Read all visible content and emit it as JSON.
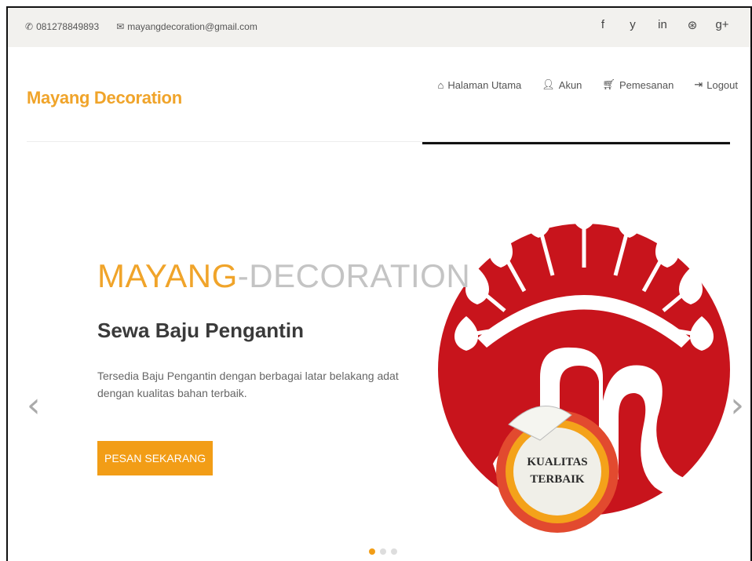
{
  "topbar": {
    "phone": "081278849893",
    "email": "mayangdecoration@gmail.com",
    "social": [
      "f",
      "y",
      "in",
      "⊛",
      "g+"
    ]
  },
  "header": {
    "brand": "Mayang Decoration",
    "nav": [
      {
        "icon": "home-icon",
        "label": "Halaman Utama"
      },
      {
        "icon": "user-icon",
        "label": "Akun"
      },
      {
        "icon": "cart-icon",
        "label": "Pemesanan"
      },
      {
        "icon": "logout-icon",
        "label": "Logout"
      }
    ]
  },
  "slide": {
    "headline_accent": "MAYANG",
    "headline_rest": "-DECORATION",
    "subhead": "Sewa Baju Pengantin",
    "description": "Tersedia Baju Pengantin dengan berbagai latar belakang adat dengan kualitas bahan terbaik.",
    "cta": "PESAN SEKARANG",
    "badge_line1": "KUALITAS",
    "badge_line2": "TERBAIK",
    "prev": "‹",
    "next": "›",
    "active_dot": 0,
    "dot_count": 3
  },
  "colors": {
    "accent": "#f0a42a",
    "button": "#f29d16",
    "logo_red": "#c8141c"
  }
}
